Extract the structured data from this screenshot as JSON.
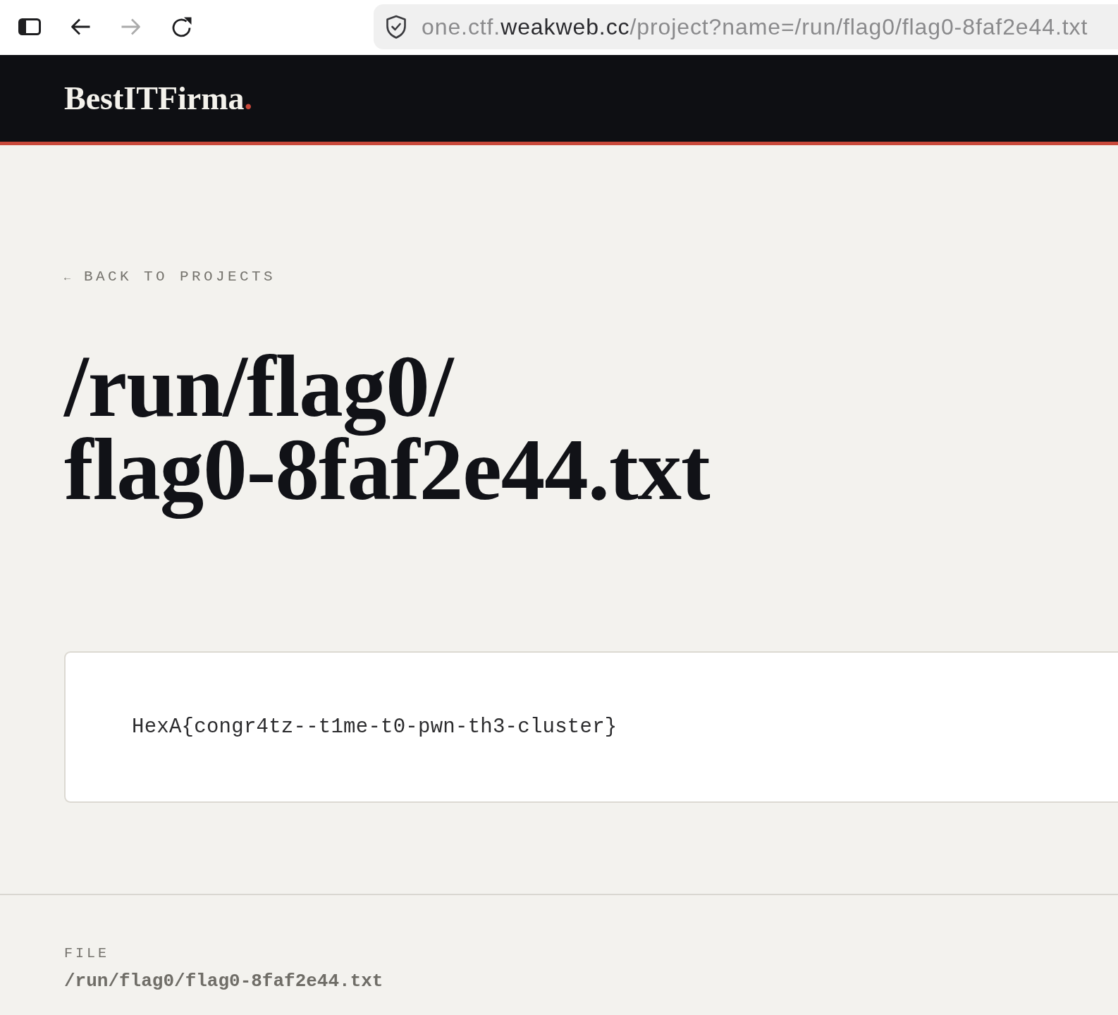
{
  "browser": {
    "toolbar_buttons": [
      {
        "kind": "sidebar",
        "disabled": false
      },
      {
        "kind": "back",
        "disabled": false
      },
      {
        "kind": "forward",
        "disabled": true
      },
      {
        "kind": "reload",
        "disabled": false
      }
    ],
    "address_bar": {
      "url_prefix": "one.ctf.",
      "url_domain": "weakweb.cc",
      "url_path": "/project?name=/run/flag0/flag0-8faf2e44.txt"
    }
  },
  "header": {
    "logo": {
      "name": "BestITFirma",
      "accent": "."
    }
  },
  "back_link": {
    "arrow": "←",
    "label": "BACK TO PROJECTS"
  },
  "title": "/run/flag0/flag0-8faf2e44.txt",
  "file_content": "HexA{congr4tz--t1me-t0-pwn-th3-cluster}",
  "footer": {
    "label": "FILE",
    "path": "/run/flag0/flag0-8faf2e44.txt"
  }
}
